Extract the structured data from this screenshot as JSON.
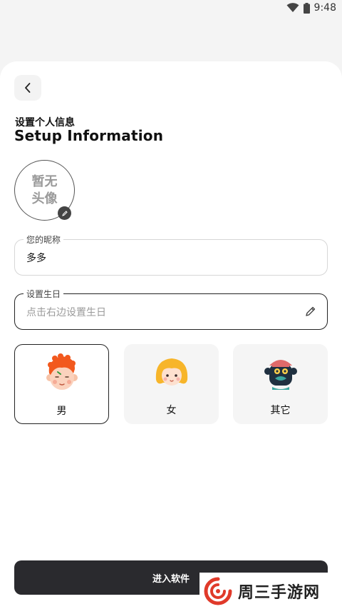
{
  "status": {
    "time": "9:48"
  },
  "header": {
    "title_cn": "设置个人信息",
    "title_en": "Setup Information"
  },
  "avatar": {
    "placeholder": "暂无头像"
  },
  "nickname": {
    "label": "您的昵称",
    "value": "多多"
  },
  "birthday": {
    "label": "设置生日",
    "placeholder": "点击右边设置生日"
  },
  "gender": {
    "options": [
      {
        "label": "男",
        "selected": true
      },
      {
        "label": "女",
        "selected": false
      },
      {
        "label": "其它",
        "selected": false
      }
    ]
  },
  "actions": {
    "enter_label": "进入软件"
  },
  "watermark": {
    "text": "周三手游网"
  }
}
